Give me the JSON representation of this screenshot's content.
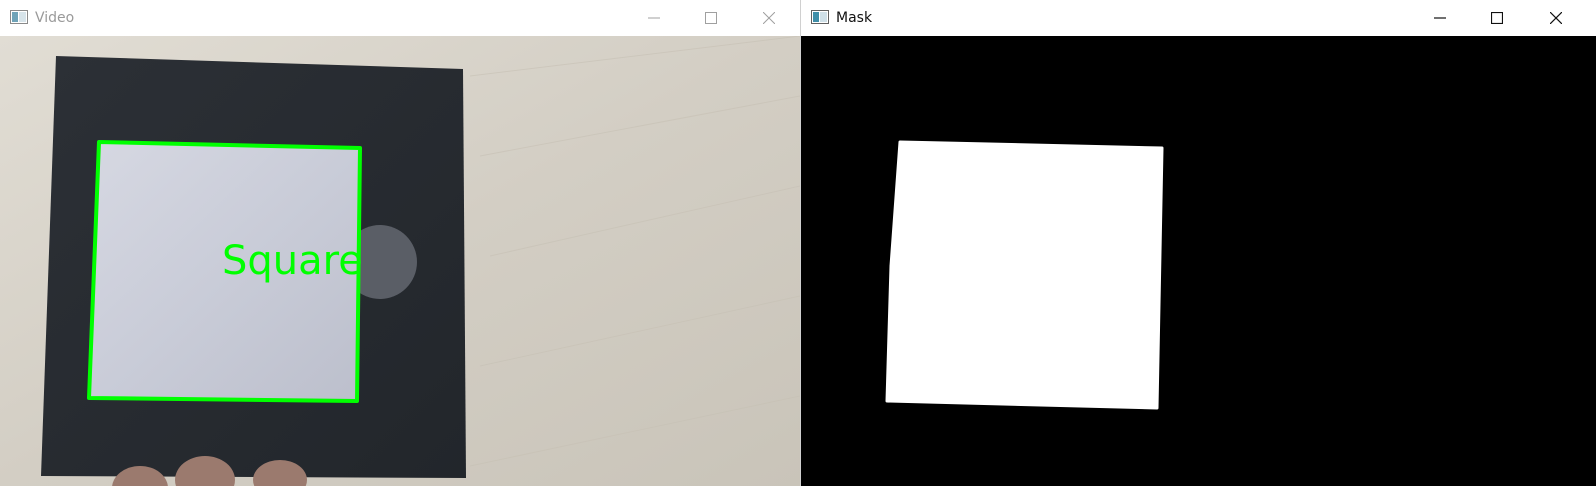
{
  "windows": {
    "video": {
      "title": "Video",
      "detected_shape_label": "Square",
      "contour_color": "#00ff00"
    },
    "mask": {
      "title": "Mask",
      "foreground_color": "#ffffff",
      "background_color": "#000000"
    }
  },
  "window_controls": [
    "minimize-icon",
    "maximize-icon",
    "close-icon"
  ]
}
